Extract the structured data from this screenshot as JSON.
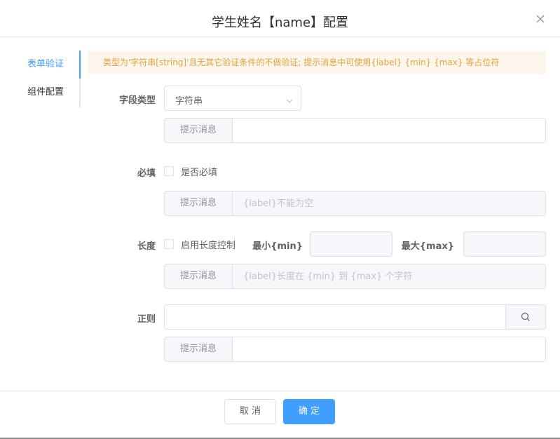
{
  "dialog": {
    "title": "学生姓名【name】配置"
  },
  "tabs": [
    {
      "label": "表单验证",
      "active": true
    },
    {
      "label": "组件配置",
      "active": false
    }
  ],
  "alert": {
    "text": "类型为'字符串[string]'且无其它验证条件的不做验证; 提示消息中可使用{label} {min} {max} 等占位符"
  },
  "field_type": {
    "label": "字段类型",
    "value": "字符串",
    "message_prefix": "提示消息",
    "message_value": ""
  },
  "required": {
    "label": "必填",
    "checkbox_label": "是否必填",
    "checked": false,
    "message_prefix": "提示消息",
    "message_placeholder": "{label}不能为空"
  },
  "length": {
    "label": "长度",
    "checkbox_label": "启用长度控制",
    "checked": false,
    "min_label": "最小{min}",
    "max_label": "最大{max}",
    "min_value": "",
    "max_value": "",
    "message_prefix": "提示消息",
    "message_placeholder": "{label}长度在 {min} 到 {max} 个字符"
  },
  "regex": {
    "label": "正则",
    "value": "",
    "message_prefix": "提示消息",
    "message_value": ""
  },
  "footer": {
    "cancel_label": "取 消",
    "ok_label": "确 定"
  },
  "colors": {
    "primary": "#409eff",
    "warning": "#e6a23c",
    "warning_bg": "#fdf6ec",
    "border": "#dcdfe6"
  }
}
